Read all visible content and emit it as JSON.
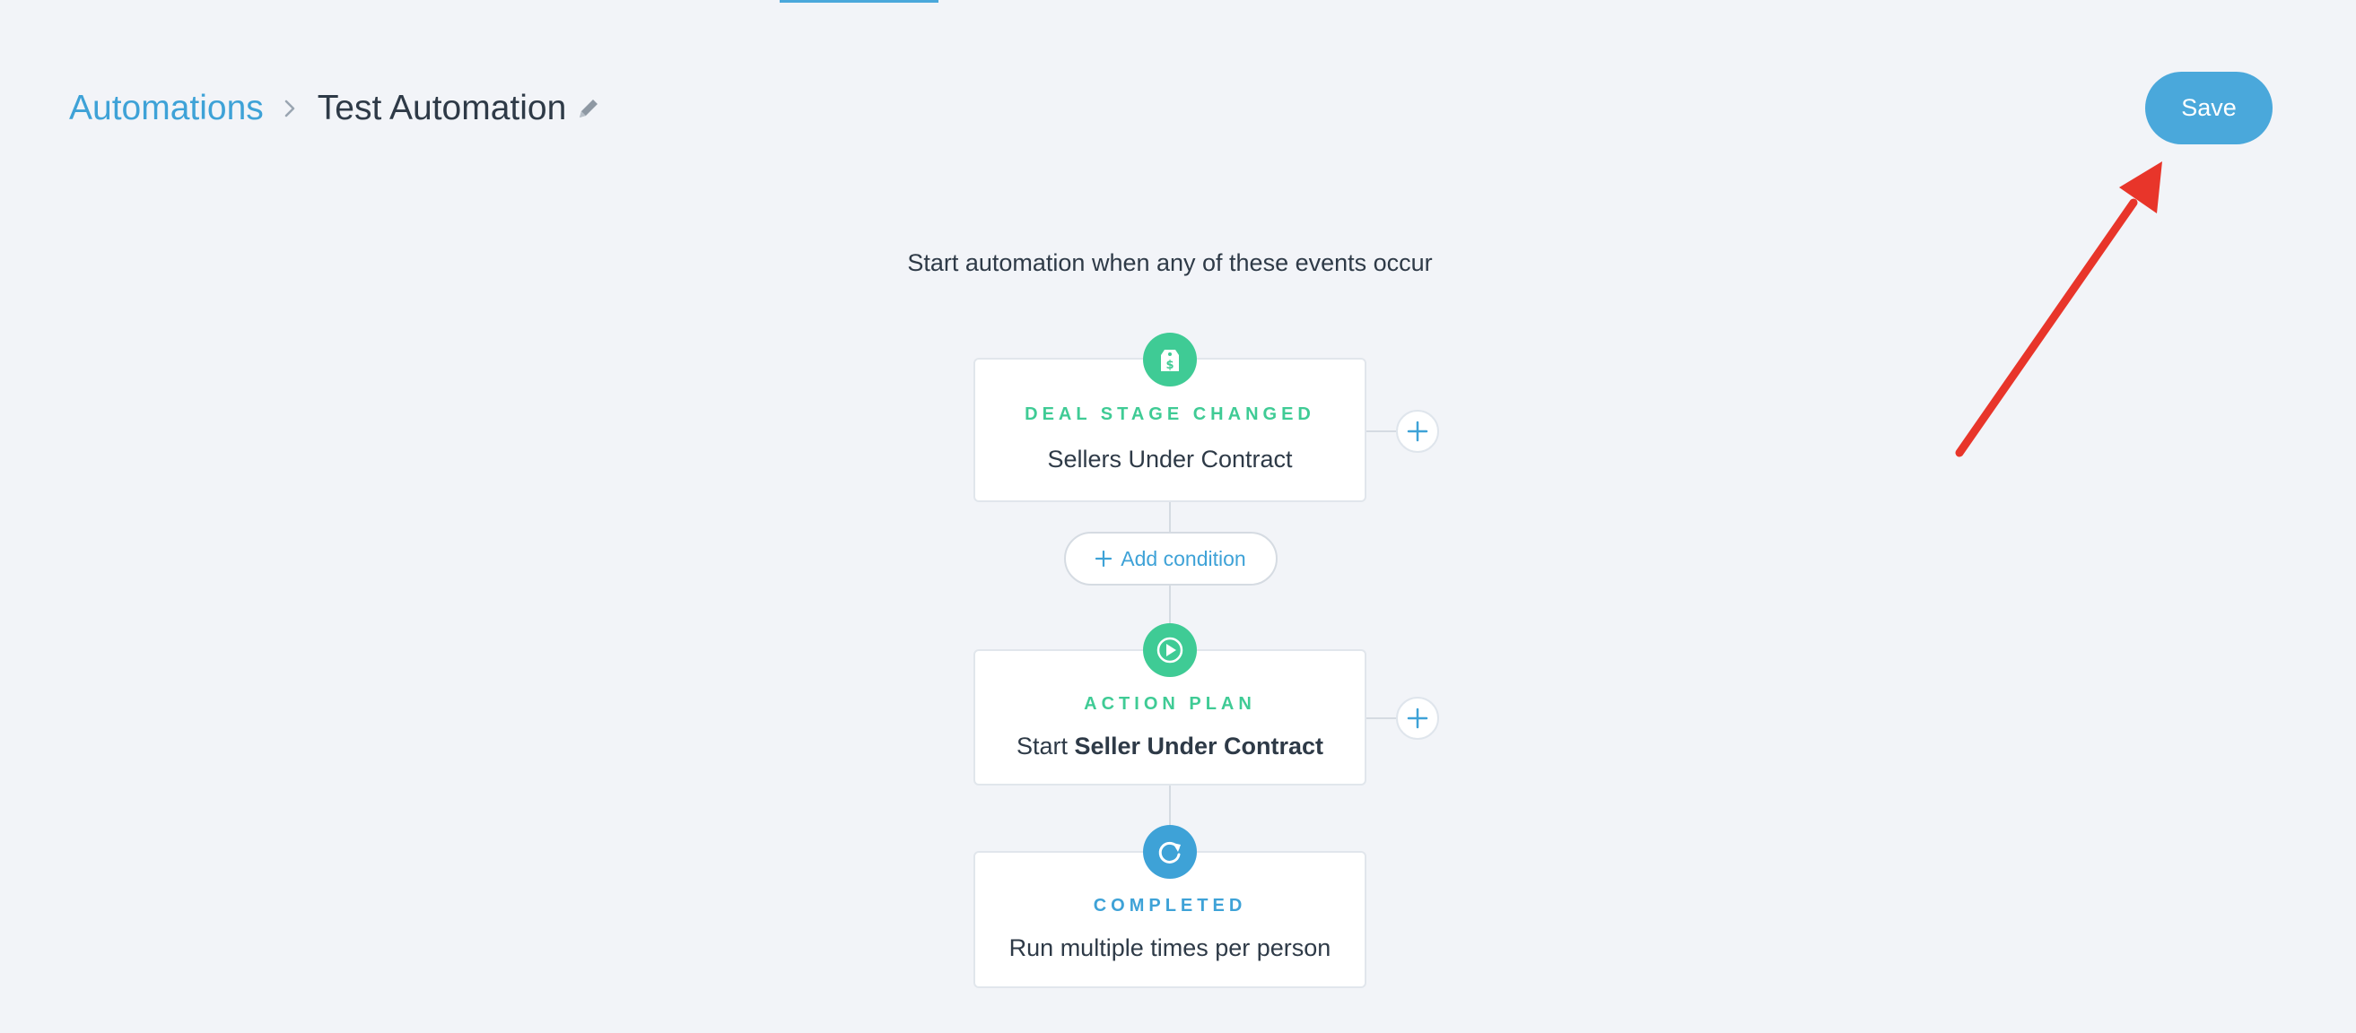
{
  "breadcrumb": {
    "parent": "Automations",
    "current": "Test Automation"
  },
  "header": {
    "save_label": "Save"
  },
  "flow": {
    "heading": "Start automation when any of these events occur",
    "trigger": {
      "type": "DEAL STAGE CHANGED",
      "detail": "Sellers Under Contract",
      "icon": "deal-tag-icon"
    },
    "add_condition_label": "Add condition",
    "action": {
      "type": "ACTION PLAN",
      "detail_prefix": "Start",
      "detail_bold": "Seller Under Contract",
      "icon": "play-icon"
    },
    "completed": {
      "type": "COMPLETED",
      "detail": "Run multiple times per person",
      "icon": "refresh-icon"
    }
  },
  "colors": {
    "accent_blue": "#3ea2d7",
    "accent_green": "#3fcb95",
    "background": "#f2f4f8",
    "annotation_red": "#e8352a"
  }
}
